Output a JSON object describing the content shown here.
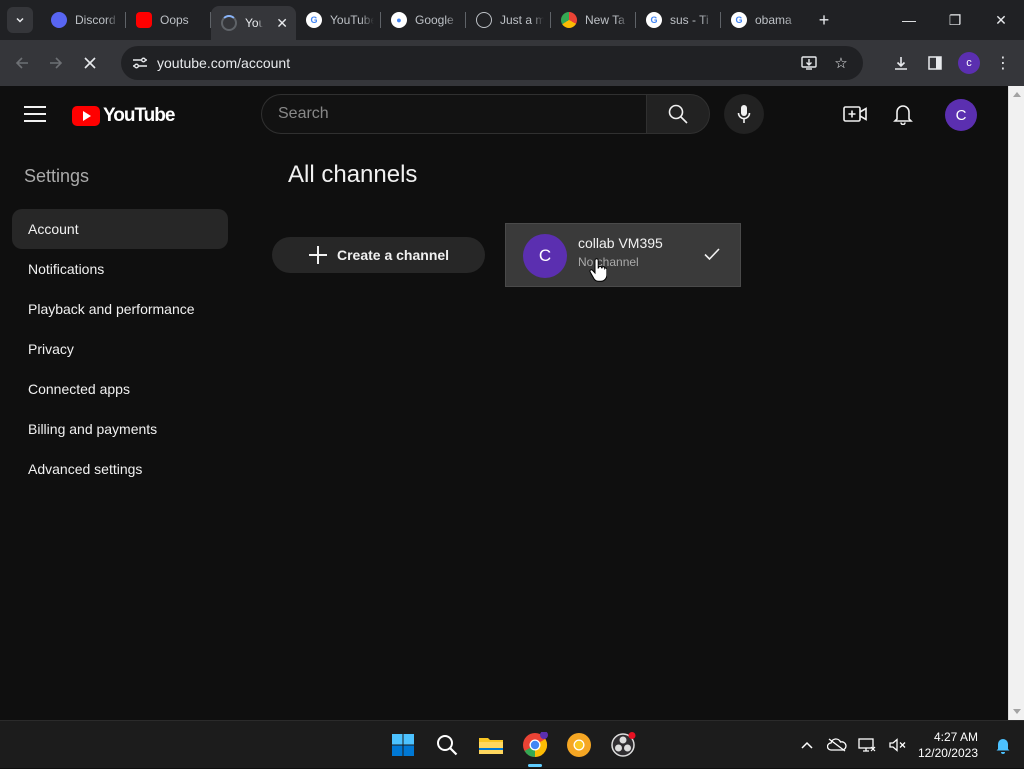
{
  "browser": {
    "tabs": [
      {
        "title": "Discord",
        "favicon": "discord-icon"
      },
      {
        "title": "Oops",
        "favicon": "youtube-icon"
      },
      {
        "title": "YouTube",
        "favicon": "loading-spinner-icon",
        "active": true
      },
      {
        "title": "YouTube",
        "favicon": "google-icon"
      },
      {
        "title": "Google",
        "favicon": "google-lens-icon"
      },
      {
        "title": "Just a m",
        "favicon": "globe-icon"
      },
      {
        "title": "New Ta",
        "favicon": "chrome-icon"
      },
      {
        "title": "sus - Ti",
        "favicon": "google-icon"
      },
      {
        "title": "obama",
        "favicon": "google-icon"
      }
    ],
    "url": "youtube.com/account",
    "profile_initial": "c"
  },
  "youtube": {
    "logo_text": "YouTube",
    "search_placeholder": "Search",
    "avatar_initial": "C",
    "settings_title": "Settings",
    "nav": [
      {
        "label": "Account",
        "active": true
      },
      {
        "label": "Notifications"
      },
      {
        "label": "Playback and performance"
      },
      {
        "label": "Privacy"
      },
      {
        "label": "Connected apps"
      },
      {
        "label": "Billing and payments"
      },
      {
        "label": "Advanced settings"
      }
    ],
    "main_title": "All channels",
    "create_channel_label": "Create a channel",
    "channel": {
      "initial": "C",
      "name": "collab VM395",
      "subtitle": "No channel"
    }
  },
  "taskbar": {
    "time": "4:27 AM",
    "date": "12/20/2023"
  },
  "colors": {
    "page_bg": "#0f0f0f",
    "accent_avatar": "#5b2fb0",
    "youtube_red": "#ff0000"
  }
}
